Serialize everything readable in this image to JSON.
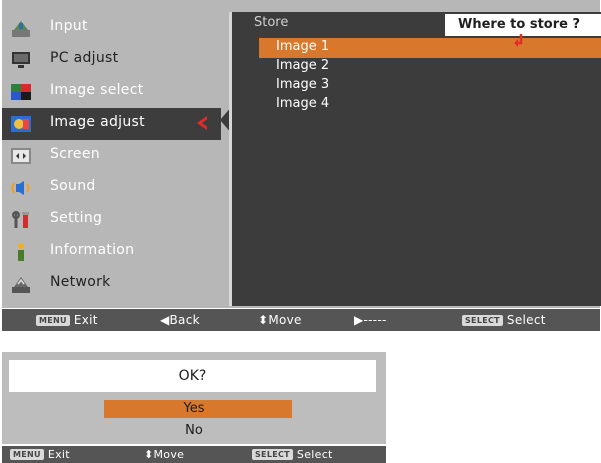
{
  "menu": {
    "items": [
      {
        "label": "Input",
        "icon": "input-icon"
      },
      {
        "label": "PC adjust",
        "icon": "pc-adjust-icon"
      },
      {
        "label": "Image select",
        "icon": "image-select-icon"
      },
      {
        "label": "Image adjust",
        "icon": "image-adjust-icon"
      },
      {
        "label": "Screen",
        "icon": "screen-icon"
      },
      {
        "label": "Sound",
        "icon": "sound-icon"
      },
      {
        "label": "Setting",
        "icon": "setting-icon"
      },
      {
        "label": "Information",
        "icon": "information-icon"
      },
      {
        "label": "Network",
        "icon": "network-icon"
      }
    ],
    "active_index": 3
  },
  "store": {
    "title": "Store",
    "where_label": "Where to store ?",
    "images": [
      "Image 1",
      "Image 2",
      "Image 3",
      "Image 4"
    ],
    "selected_index": 0
  },
  "help_bar": {
    "exit_key": "MENU",
    "exit": "Exit",
    "back": "◀Back",
    "move": "⬍Move",
    "next": "▶-----",
    "select_key": "SELECT",
    "select": "Select"
  },
  "dialog": {
    "prompt": "OK?",
    "yes": "Yes",
    "no": "No",
    "exit_key": "MENU",
    "exit": "Exit",
    "move": "⬍Move",
    "select_key": "SELECT",
    "select": "Select"
  },
  "colors": {
    "accent": "#d8782d",
    "panel": "#b7b7b7",
    "pane": "#3c3c3c",
    "arrow": "#e22c2c"
  }
}
